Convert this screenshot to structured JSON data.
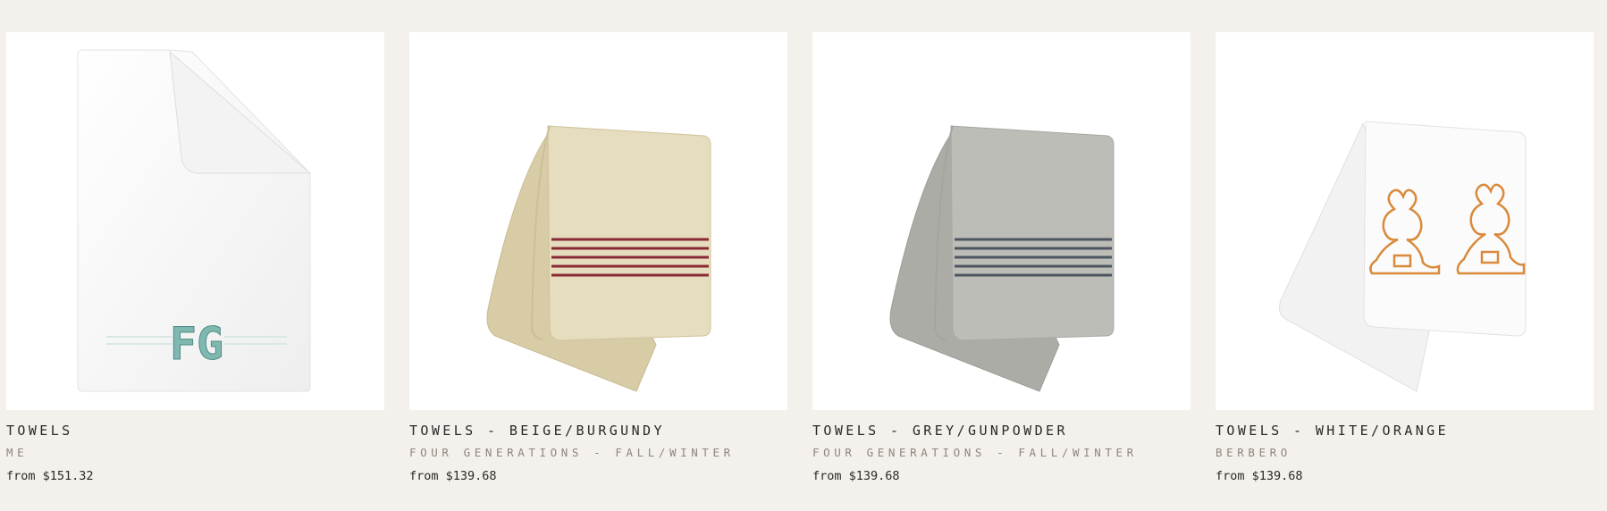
{
  "products": [
    {
      "title": "TOWELS",
      "subtitle": "ME",
      "price": "from $151.32",
      "image_icon": "white-towel-monogram-image",
      "monogram": "FG",
      "colors": {
        "towel": "#fbfbfb",
        "accent": "#7fb8b0"
      }
    },
    {
      "title": "TOWELS - BEIGE/BURGUNDY",
      "subtitle": "FOUR GENERATIONS - FALL/WINTER",
      "price": "from $139.68",
      "image_icon": "beige-towel-stripes-image",
      "colors": {
        "towel": "#e6dcbe",
        "accent": "#8a2a34"
      }
    },
    {
      "title": "TOWELS - GREY/GUNPOWDER",
      "subtitle": "FOUR GENERATIONS - FALL/WINTER",
      "price": "from $139.68",
      "image_icon": "grey-towel-stripes-image",
      "colors": {
        "towel": "#bdbdb7",
        "accent": "#4c5560"
      }
    },
    {
      "title": "TOWELS - WHITE/ORANGE",
      "subtitle": "BERBERO",
      "price": "from $139.68",
      "image_icon": "white-towel-orange-embroidery-image",
      "colors": {
        "towel": "#fbfbfb",
        "accent": "#d98a3a"
      }
    }
  ]
}
